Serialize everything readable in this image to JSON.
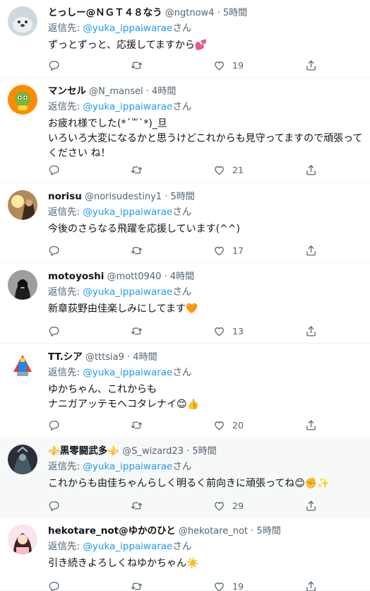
{
  "replying_label": "返信先: ",
  "replying_suffix": "さん",
  "dot": "·",
  "icons": {
    "reply": "reply-icon",
    "retweet": "retweet-icon",
    "like": "heart-icon",
    "share": "share-icon"
  },
  "colors": {
    "mention": "#1d9bf0",
    "secondary": "#536471",
    "emoji_heart": "#e63e73",
    "emoji_orange_heart": "#f4900c"
  },
  "replies": [
    {
      "name": "とっしー@ＮＧＴ４８なう",
      "handle": "@ngtnow4",
      "time": "5時間",
      "reply_to": "@yuka_ippaiwarae",
      "text": "ずっとずっと、応援してますから💕",
      "likes": "19"
    },
    {
      "name": "マンセル",
      "handle": "@N_mansel",
      "time": "4時間",
      "reply_to": "@yuka_ippaiwarae",
      "text": "お疲れ様でした(*´꒳`*)_旦\nいろいろ大変になるかと思うけどこれからも見守ってますので頑張ってください ね！",
      "likes": "21"
    },
    {
      "name": "norisu",
      "handle": "@norisudestiny1",
      "time": "5時間",
      "reply_to": "@yuka_ippaiwarae",
      "text": "今後のさらなる飛躍を応援しています(^^)",
      "likes": "17"
    },
    {
      "name": "motoyoshi",
      "handle": "@mott0940",
      "time": "4時間",
      "reply_to": "@yuka_ippaiwarae",
      "text": "新章荻野由佳楽しみにしてます🧡",
      "likes": "13"
    },
    {
      "name": "TT.シア",
      "handle": "@tttsia9",
      "time": "4時間",
      "reply_to": "@yuka_ippaiwarae",
      "text": "ゆかちゃん、これからも\nナニガアッテモヘコタレナイ😊👍",
      "likes": "20"
    },
    {
      "name": "⚜️黒零闘武多⚜️",
      "handle": "@S_wizard23",
      "time": "5時間",
      "reply_to": "@yuka_ippaiwarae",
      "text": "これからも由佳ちゃんらしく明るく前向きに頑張ってね😊✊✨",
      "likes": "29"
    },
    {
      "name": "hekotare_not@ゆかのひと",
      "handle": "@hekotare_not",
      "time": "5時間",
      "reply_to": "@yuka_ippaiwarae",
      "text": "引き続きよろしくねゆかちゃん☀️",
      "likes": "19"
    }
  ]
}
